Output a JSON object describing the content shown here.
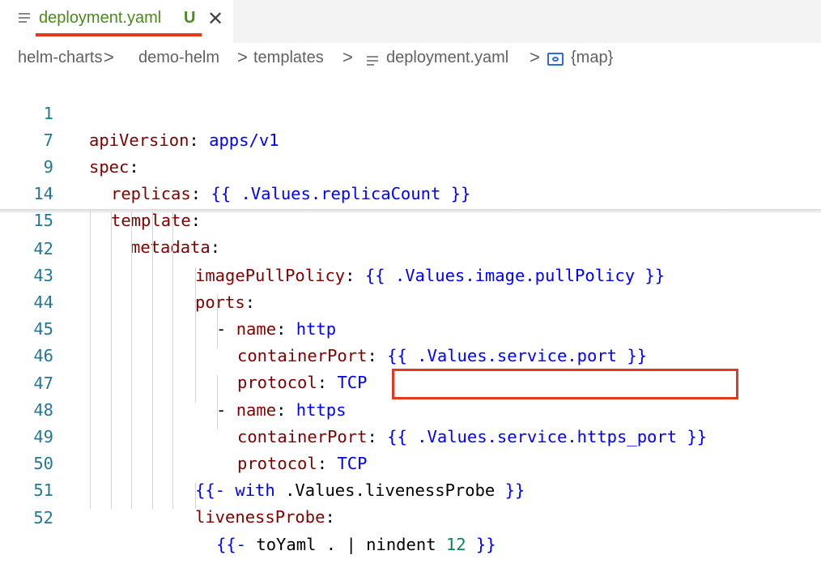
{
  "tab": {
    "filename": "deployment.yaml",
    "status": "U",
    "close": "✕"
  },
  "breadcrumb": {
    "items": [
      "helm-charts",
      "demo-helm",
      "templates",
      "deployment.yaml",
      "{map}"
    ],
    "separator": ">"
  },
  "editor": {
    "sticky_lines": [
      {
        "num": "1",
        "indent": "",
        "key": "apiVersion",
        "punct": ": ",
        "value": "apps/v1"
      },
      {
        "num": "7",
        "indent": "",
        "key": "spec",
        "punct": ":",
        "value": ""
      },
      {
        "num": "9",
        "indent": "  ",
        "key": "replicas",
        "punct": ": ",
        "value": "{{ .Values.replicaCount }}"
      },
      {
        "num": "14",
        "indent": "  ",
        "key": "template",
        "punct": ":",
        "value": ""
      },
      {
        "num": "15",
        "indent": "    ",
        "key": "metadata",
        "punct": ":",
        "value": ""
      }
    ],
    "lines": [
      {
        "num": "42",
        "text_key": "imagePullPolicy",
        "text_value": "{{ .Values.image.pullPolicy }}"
      },
      {
        "num": "43",
        "text_key": "ports",
        "text_value": ""
      },
      {
        "num": "44",
        "text_key": "name",
        "text_value": "http"
      },
      {
        "num": "45",
        "text_key": "containerPort",
        "text_value": "{{ .Values.service.port }}"
      },
      {
        "num": "46",
        "text_key": "protocol",
        "text_value": "TCP"
      },
      {
        "num": "47",
        "text_key": "name",
        "text_value": "https"
      },
      {
        "num": "48",
        "text_key": "containerPort",
        "text_value": "{{ .Values.service.https_port }}"
      },
      {
        "num": "49",
        "text_key": "protocol",
        "text_value": "TCP"
      },
      {
        "num": "50",
        "text_key": "{{- with",
        "text_value": ".Values.livenessProbe }}"
      },
      {
        "num": "51",
        "text_key": "livenessProbe",
        "text_value": ""
      },
      {
        "num": "52",
        "text_key": "{{- toYaml . | nindent",
        "text_value": "12 }}"
      }
    ],
    "extra": {
      "dash": "- ",
      "colon": ":",
      "colon_sp": ": ",
      "with_open": "{{-",
      "with_word": " with ",
      "with_rest": ".Values.livenessProbe ",
      "with_close": "}}",
      "toyaml_open": "{{-",
      "toyaml_mid": " toYaml . | nindent ",
      "toyaml_num": "12",
      "toyaml_close": " }}"
    }
  },
  "colors": {
    "key": "#800000",
    "value": "#0000ff",
    "line_number": "#237893",
    "highlight": "#e2391f",
    "tab_label": "#4b8a1a"
  }
}
